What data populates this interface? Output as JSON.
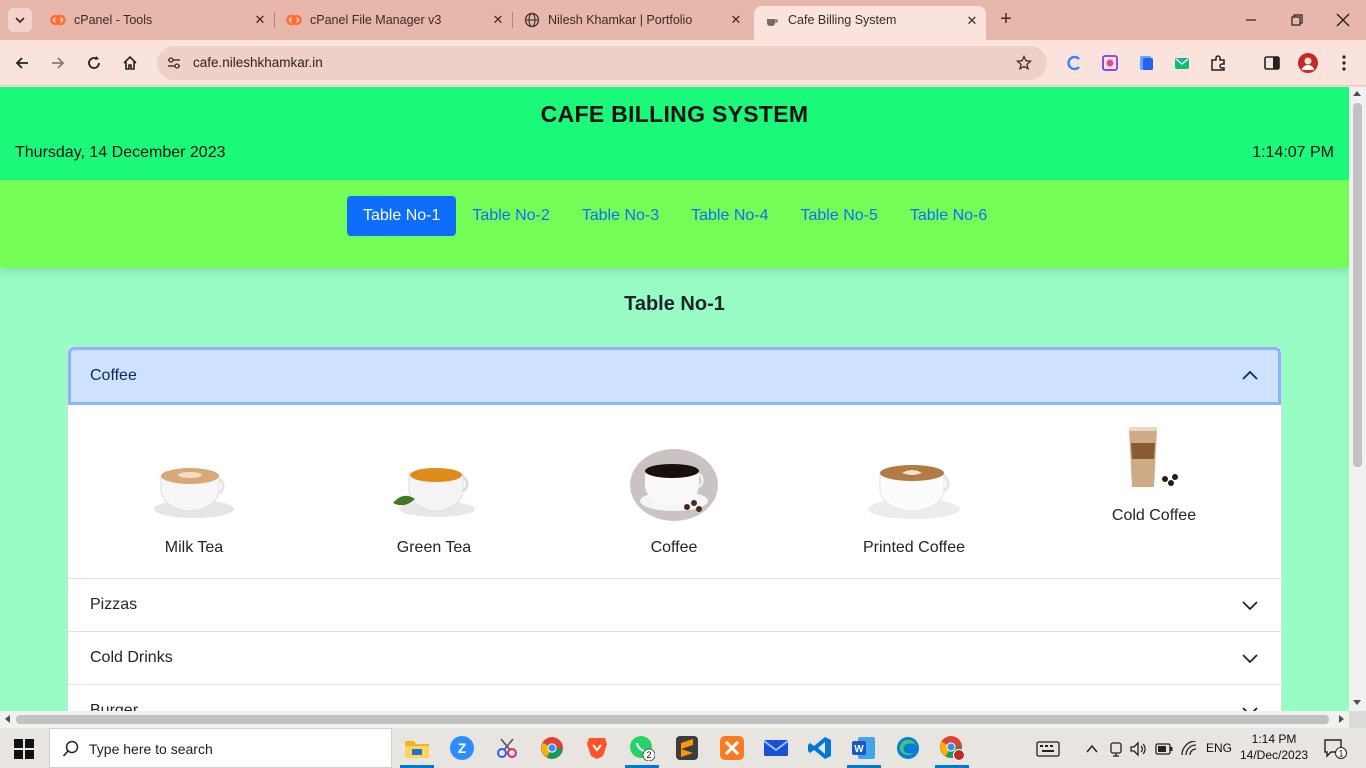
{
  "browser": {
    "tabs": [
      {
        "title": "cPanel - Tools",
        "icon": "cpanel-icon"
      },
      {
        "title": "cPanel File Manager v3",
        "icon": "cpanel-icon"
      },
      {
        "title": "Nilesh Khamkar | Portfolio",
        "icon": "globe-icon"
      },
      {
        "title": "Cafe Billing System",
        "icon": "coffee-cup-icon"
      }
    ],
    "url": "cafe.nileshkhamkar.in"
  },
  "app": {
    "title": "CAFE BILLING SYSTEM",
    "date": "Thursday, 14 December 2023",
    "time": "1:14:07 PM",
    "tables": [
      "Table No-1",
      "Table No-2",
      "Table No-3",
      "Table No-4",
      "Table No-5",
      "Table No-6"
    ],
    "active_table": "Table No-1",
    "section_title": "Table No-1",
    "categories": [
      {
        "name": "Coffee",
        "open": true,
        "items": [
          "Milk Tea",
          "Green Tea",
          "Coffee",
          "Printed Coffee",
          "Cold Coffee"
        ]
      },
      {
        "name": "Pizzas",
        "open": false
      },
      {
        "name": "Cold Drinks",
        "open": false
      },
      {
        "name": "Burger",
        "open": false
      }
    ]
  },
  "taskbar": {
    "search_placeholder": "Type here to search",
    "whatsapp_badge": "2",
    "language": "ENG",
    "clock_time": "1:14 PM",
    "clock_date": "14/Dec/2023",
    "notifications": "1"
  },
  "colors": {
    "header": "#1af979",
    "nav": "#75fd57",
    "page": "#98fdc5",
    "primary": "#0d6efd",
    "accordion_open": "#cfe2ff"
  }
}
